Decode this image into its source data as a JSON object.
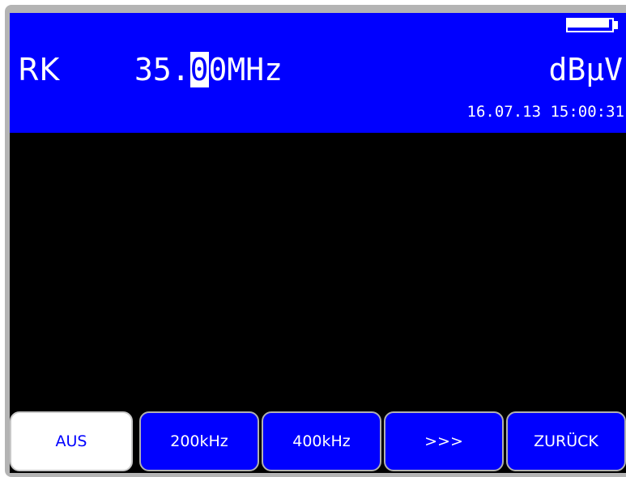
{
  "header": {
    "mode": "RK",
    "frequency": {
      "before_cursor": "35.",
      "cursor_digit": "0",
      "after_cursor": "0MHz"
    },
    "unit": "dBµV",
    "datetime": "16.07.13 15:00:31",
    "battery_icon": "battery-full-icon",
    "battery_level_fraction": 1.0
  },
  "softkeys": [
    {
      "label": "AUS",
      "active": true
    },
    {
      "label": "200kHz",
      "active": false
    },
    {
      "label": "400kHz",
      "active": false
    },
    {
      "label": ">>>",
      "active": false
    },
    {
      "label": "ZURÜCK",
      "active": false
    }
  ],
  "colors": {
    "header_background": "#0000ff",
    "screen_background": "#000000",
    "text": "#ffffff",
    "softkey_background": "#0000ff",
    "softkey_active_background": "#ffffff",
    "bezel": "#b4b4b4"
  }
}
